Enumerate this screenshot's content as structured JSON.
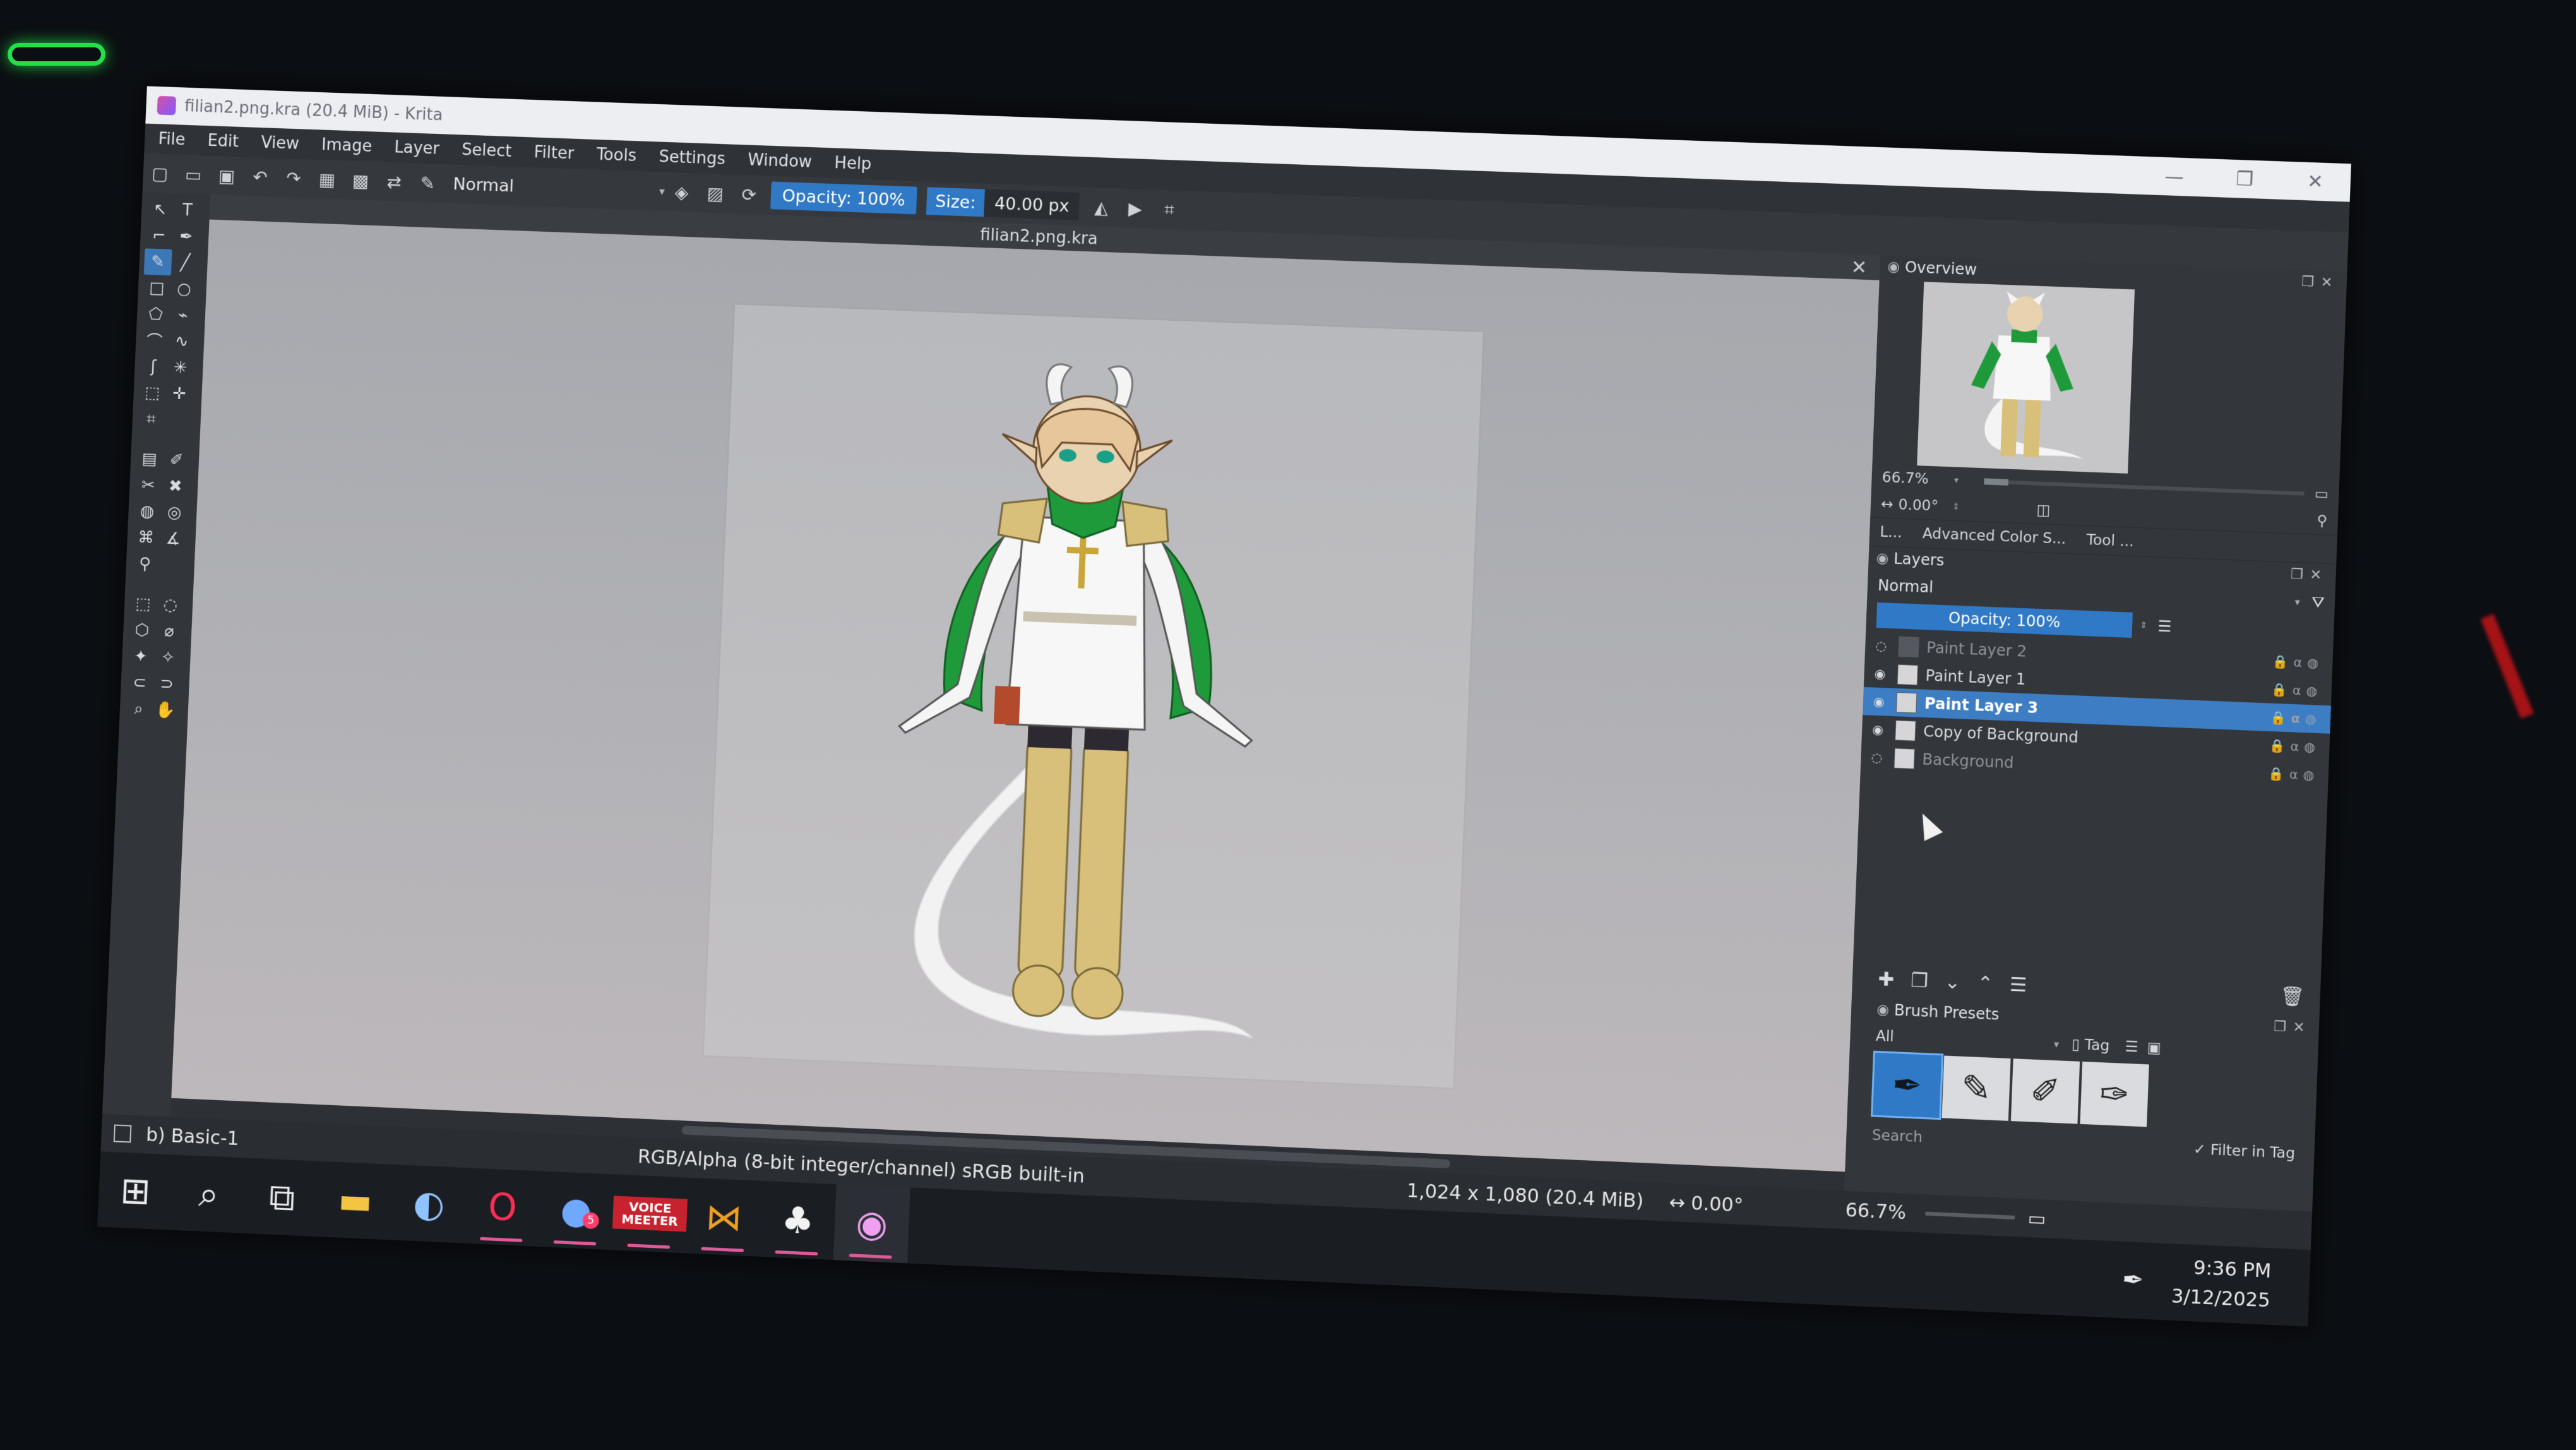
{
  "window": {
    "title": "filian2.png.kra (20.4 MiB) - Krita",
    "minimize": "—",
    "maximize": "❐",
    "close": "✕"
  },
  "menu": [
    "File",
    "Edit",
    "View",
    "Image",
    "Layer",
    "Select",
    "Filter",
    "Tools",
    "Settings",
    "Window",
    "Help"
  ],
  "toolbar": {
    "blend_mode": "Normal",
    "opacity_label": "Opacity: 100%",
    "size_label": "Size:",
    "size_value": "40.00 px"
  },
  "document": {
    "tab_title": "filian2.png.kra"
  },
  "overview": {
    "title": "Overview",
    "zoom": "66.7%",
    "rotation": "0.00°"
  },
  "dock_tabs": [
    "L...",
    "Advanced Color S...",
    "Tool ..."
  ],
  "layers": {
    "title": "Layers",
    "blend_mode": "Normal",
    "opacity": "Opacity:  100%",
    "items": [
      {
        "name": "Paint Layer 2",
        "visible": false,
        "selected": false
      },
      {
        "name": "Paint Layer 1",
        "visible": true,
        "selected": false
      },
      {
        "name": "Paint Layer 3",
        "visible": true,
        "selected": true
      },
      {
        "name": "Copy of Background",
        "visible": true,
        "selected": false
      },
      {
        "name": "Background",
        "visible": false,
        "selected": false
      }
    ]
  },
  "brush_presets": {
    "title": "Brush Presets",
    "filter": "All",
    "tag_label": "Tag",
    "search_placeholder": "Search",
    "filter_in_tag": "✓ Filter in Tag"
  },
  "status": {
    "brush": "b) Basic-1",
    "color_space": "RGB/Alpha (8-bit integer/channel)  sRGB built-in",
    "dimensions": "1,024 x 1,080 (20.4 MiB)",
    "rotation": "0.00°",
    "zoom": "66.7%"
  },
  "taskbar": {
    "voicemeeter_label": "VOICE MEETER",
    "notification_badge": "5",
    "time": "9:36 PM",
    "date": "3/12/2025"
  },
  "colors": {
    "accent": "#2f79c6",
    "selected_layer": "#3d7dc4",
    "character_green": "#1f9a3a",
    "character_gold": "#d8bf7a"
  }
}
